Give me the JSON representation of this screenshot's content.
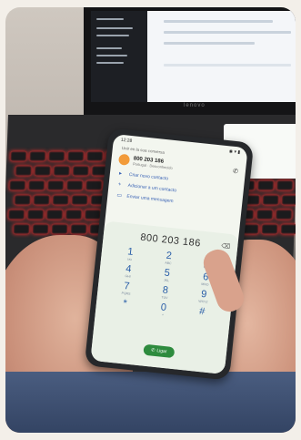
{
  "laptop": {
    "brand": "lenovo"
  },
  "phone": {
    "status": {
      "time": "12:28",
      "icons": "◉ ▾ ▮"
    },
    "header": "Unir en la sua conversa",
    "contact": {
      "number": "800 203 186",
      "subtitle": "Portugal · Desconhecido"
    },
    "actions": [
      {
        "icon": "video-icon",
        "label": "Criar novo contacto"
      },
      {
        "icon": "person-add-icon",
        "label": "Adicionar a um contacto"
      },
      {
        "icon": "message-icon",
        "label": "Enviar uma mensagem"
      }
    ],
    "dialpad": {
      "typed": "800 203 186",
      "keys": [
        {
          "d": "1",
          "l": "ωω"
        },
        {
          "d": "2",
          "l": "ABC"
        },
        {
          "d": "3",
          "l": "DEF"
        },
        {
          "d": "4",
          "l": "GHI"
        },
        {
          "d": "5",
          "l": "JKL"
        },
        {
          "d": "6",
          "l": "MNO"
        },
        {
          "d": "7",
          "l": "PQRS"
        },
        {
          "d": "8",
          "l": "TUV"
        },
        {
          "d": "9",
          "l": "WXYZ"
        },
        {
          "d": "*",
          "l": ""
        },
        {
          "d": "0",
          "l": "+"
        },
        {
          "d": "#",
          "l": ""
        }
      ],
      "call_label": "Ligar"
    }
  }
}
